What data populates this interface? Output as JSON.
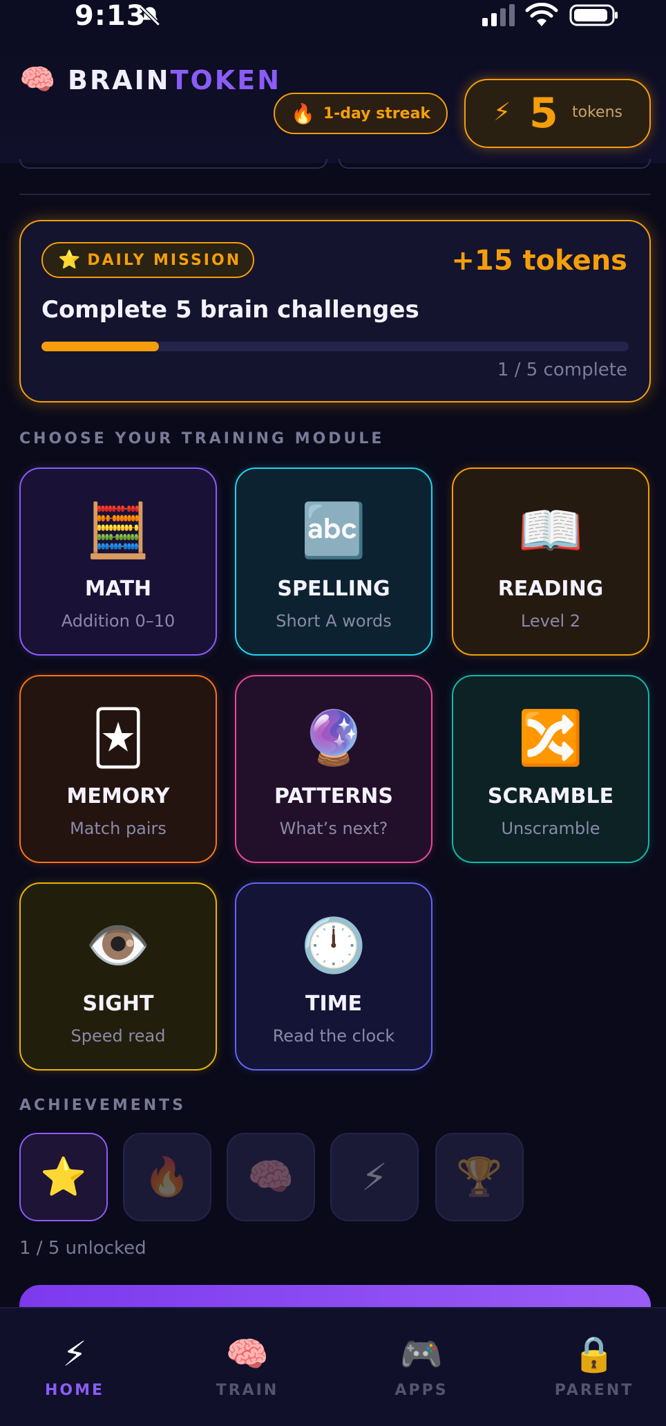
{
  "status_bar": {
    "time": "9:13"
  },
  "header": {
    "logo_icon": "🧠",
    "brand_part1": "BRAIN",
    "brand_part2": "TOKEN",
    "streak_icon": "🔥",
    "streak_label": "1-day streak",
    "tokens_icon": "⚡",
    "tokens_count": "5",
    "tokens_label": "tokens"
  },
  "mission": {
    "badge_icon": "⭐",
    "badge_label": "DAILY MISSION",
    "reward": "+15 tokens",
    "title": "Complete 5 brain challenges",
    "progress": 0.2,
    "progress_text": "1 / 5 complete"
  },
  "modules_heading": "CHOOSE YOUR TRAINING MODULE",
  "modules": [
    {
      "icon": "🧮",
      "name": "MATH",
      "subtitle": "Addition 0–10",
      "color": "#8b5cf6",
      "bg": "#1a1236"
    },
    {
      "icon": "🔤",
      "name": "SPELLING",
      "subtitle": "Short A words",
      "color": "#22d3ee",
      "bg": "#0c2230"
    },
    {
      "icon": "📖",
      "name": "READING",
      "subtitle": "Level 2",
      "color": "#f59e0b",
      "bg": "#241a10"
    },
    {
      "icon": "🃏",
      "name": "MEMORY",
      "subtitle": "Match pairs",
      "color": "#f97316",
      "bg": "#241410"
    },
    {
      "icon": "🔮",
      "name": "PATTERNS",
      "subtitle": "What’s next?",
      "color": "#ec4899",
      "bg": "#22102a"
    },
    {
      "icon": "🔀",
      "name": "SCRAMBLE",
      "subtitle": "Unscramble",
      "color": "#14b8a6",
      "bg": "#0c2224"
    },
    {
      "icon": "👁️",
      "name": "SIGHT",
      "subtitle": "Speed read",
      "color": "#eab308",
      "bg": "#221e0c"
    },
    {
      "icon": "🕛",
      "name": "TIME",
      "subtitle": "Read the clock",
      "color": "#6366f1",
      "bg": "#141436"
    }
  ],
  "achievements_heading": "ACHIEVEMENTS",
  "achievements": [
    {
      "icon": "⭐",
      "unlocked": true
    },
    {
      "icon": "🔥",
      "unlocked": false
    },
    {
      "icon": "🧠",
      "unlocked": false
    },
    {
      "icon": "⚡",
      "unlocked": false
    },
    {
      "icon": "🏆",
      "unlocked": false
    }
  ],
  "achievements_count": "1 / 5 unlocked",
  "tabs": [
    {
      "icon": "⚡",
      "label": "HOME",
      "active": true
    },
    {
      "icon": "🧠",
      "label": "TRAIN",
      "active": false
    },
    {
      "icon": "🎮",
      "label": "APPS",
      "active": false
    },
    {
      "icon": "🔒",
      "label": "PARENT",
      "active": false
    }
  ]
}
